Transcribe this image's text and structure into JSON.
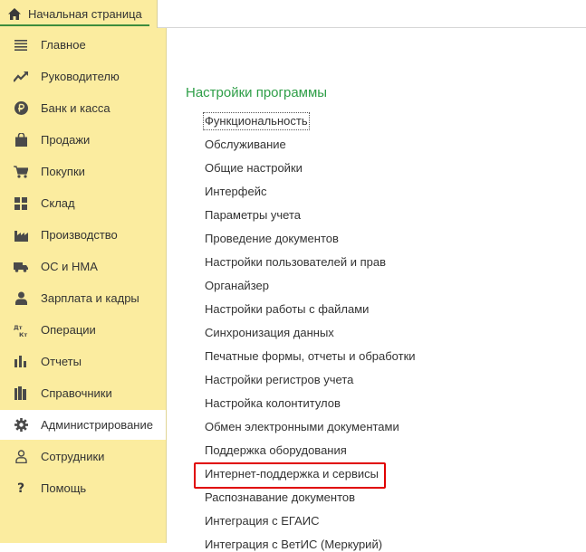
{
  "home_tab": {
    "label": "Начальная страница",
    "icon": "home-icon"
  },
  "sidebar": {
    "items": [
      {
        "label": "Главное",
        "icon": "menu-lines-icon"
      },
      {
        "label": "Руководителю",
        "icon": "trend-icon"
      },
      {
        "label": "Банк и касса",
        "icon": "ruble-icon"
      },
      {
        "label": "Продажи",
        "icon": "shopping-bag-icon"
      },
      {
        "label": "Покупки",
        "icon": "cart-icon"
      },
      {
        "label": "Склад",
        "icon": "warehouse-grid-icon"
      },
      {
        "label": "Производство",
        "icon": "factory-icon"
      },
      {
        "label": "ОС и НМА",
        "icon": "truck-icon"
      },
      {
        "label": "Зарплата и кадры",
        "icon": "person-icon"
      },
      {
        "label": "Операции",
        "icon": "debit-credit-icon"
      },
      {
        "label": "Отчеты",
        "icon": "bar-chart-icon"
      },
      {
        "label": "Справочники",
        "icon": "books-icon"
      },
      {
        "label": "Администрирование",
        "icon": "gear-icon",
        "active": true
      },
      {
        "label": "Сотрудники",
        "icon": "person-outline-icon"
      },
      {
        "label": "Помощь",
        "icon": "question-icon"
      }
    ]
  },
  "main": {
    "title": "Настройки программы",
    "links": [
      "Функциональность",
      "Обслуживание",
      "Общие настройки",
      "Интерфейс",
      "Параметры учета",
      "Проведение документов",
      "Настройки пользователей и прав",
      "Органайзер",
      "Настройки работы с файлами",
      "Синхронизация данных",
      "Печатные формы, отчеты и обработки",
      "Настройки регистров учета",
      "Настройка колонтитулов",
      "Обмен электронными документами",
      "Поддержка оборудования",
      "Интернет-поддержка и сервисы",
      "Распознавание документов",
      "Интеграция с ЕГАИС",
      "Интеграция с ВетИС (Меркурий)"
    ],
    "highlighted_link": "Интернет-поддержка и сервисы"
  },
  "colors": {
    "sidebar_bg": "#fbec9f",
    "title_green": "#2e9e47",
    "highlight_red": "#e00000",
    "tab_underline": "#3d8c3d"
  }
}
